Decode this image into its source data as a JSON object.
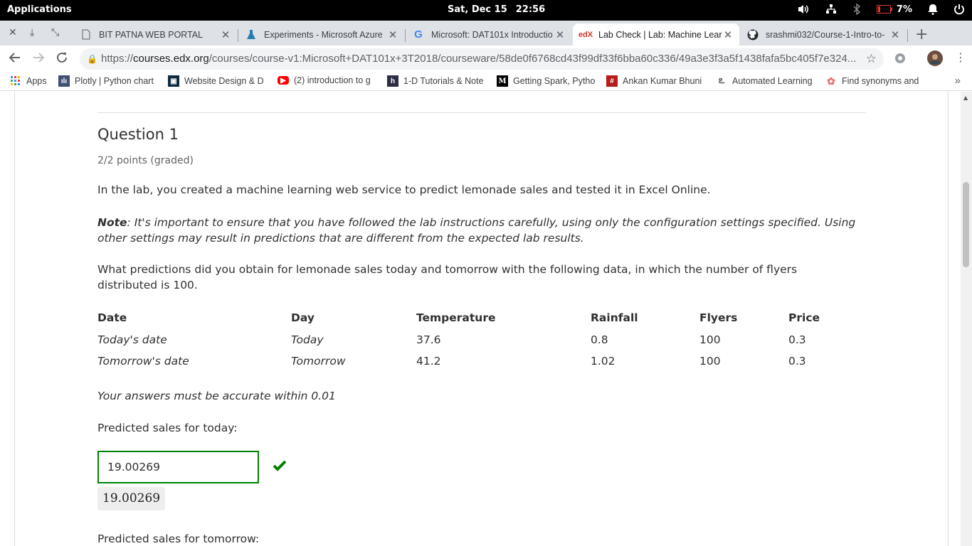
{
  "os": {
    "apps_label": "Applications",
    "date": "Sat, Dec 15",
    "time": "22:56",
    "battery_pct": "7%"
  },
  "tabs": [
    {
      "label": "BIT PATNA WEB PORTAL",
      "icon": "page-icon",
      "active": false
    },
    {
      "label": "Experiments - Microsoft Azure",
      "icon": "flask-icon",
      "active": false
    },
    {
      "label": "Microsoft: DAT101x Introductio",
      "icon": "google-icon",
      "active": false
    },
    {
      "label": "Lab Check | Lab: Machine Lear",
      "icon": "edx-icon",
      "active": true
    },
    {
      "label": "srashmi032/Course-1-Intro-to-",
      "icon": "github-icon",
      "active": false
    }
  ],
  "url": {
    "scheme": "https://",
    "host": "courses.edx.org",
    "path": "/courses/course-v1:Microsoft+DAT101x+3T2018/courseware/58de0f6768cd43f99df33f6bba60c336/49a3e3f3a5f1438fafa5bc405f7e324..."
  },
  "bookmarks": [
    {
      "label": "Apps",
      "icon": "apps-grid-icon"
    },
    {
      "label": "Plotly | Python chart",
      "icon": "plotly-icon"
    },
    {
      "label": "Website Design & D",
      "icon": "site-icon"
    },
    {
      "label": "(2) introduction to g",
      "icon": "youtube-icon"
    },
    {
      "label": "1-D Tutorials & Note",
      "icon": "h-icon"
    },
    {
      "label": "Getting Spark, Pytho",
      "icon": "medium-icon"
    },
    {
      "label": "Ankan Kumar Bhuni",
      "icon": "hash-icon"
    },
    {
      "label": "Automated Learning",
      "icon": "curl-icon"
    },
    {
      "label": "Find synonyms and",
      "icon": "synonym-icon"
    }
  ],
  "question": {
    "title": "Question 1",
    "points": "2/2 points (graded)",
    "text": "In the lab, you created a machine learning web service to predict lemonade sales and tested it in Excel Online.",
    "note_label": "Note",
    "note_text": ": It's important to ensure that you have followed the lab instructions carefully, using only the configuration settings specified. Using other settings may result in predictions that are different from the expected lab results.",
    "ask": "What predictions did you obtain for lemonade sales today and tomorrow with the following data, in which the number of flyers distributed is 100.",
    "accuracy": "Your answers must be accurate within 0.01",
    "today_label": "Predicted sales for today:",
    "today_value": "19.00269",
    "today_preview": "19.00269",
    "tomorrow_label": "Predicted sales for tomorrow:"
  },
  "table": {
    "headers": [
      "Date",
      "Day",
      "Temperature",
      "Rainfall",
      "Flyers",
      "Price"
    ],
    "rows": [
      [
        "Today's date",
        "Today",
        "37.6",
        "0.8",
        "100",
        "0.3"
      ],
      [
        "Tomorrow's date",
        "Tomorrow",
        "41.2",
        "1.02",
        "100",
        "0.3"
      ]
    ]
  },
  "colors": {
    "correct_green": "#008100",
    "edx_red": "#d23228",
    "youtube_red": "#ff0000"
  }
}
